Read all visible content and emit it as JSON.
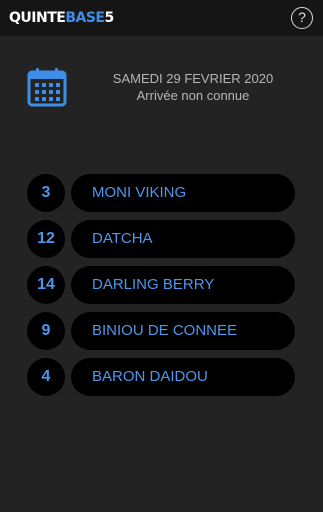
{
  "header": {
    "logo_part1": "QUINTE",
    "logo_part2": "BASE",
    "logo_part3": "5",
    "help_label": "?"
  },
  "race": {
    "date": "SAMEDI 29 FEVRIER 2020",
    "status": "Arrivée non connue"
  },
  "horses": [
    {
      "number": "3",
      "name": "MONI VIKING"
    },
    {
      "number": "12",
      "name": "DATCHA"
    },
    {
      "number": "14",
      "name": "DARLING BERRY"
    },
    {
      "number": "9",
      "name": "BINIOU DE CONNEE"
    },
    {
      "number": "4",
      "name": "BARON DAIDOU"
    }
  ],
  "colors": {
    "accent": "#4e97ec",
    "background": "#232323",
    "header": "#151515"
  },
  "icons": {
    "calendar": "calendar-icon",
    "help": "help-icon"
  }
}
